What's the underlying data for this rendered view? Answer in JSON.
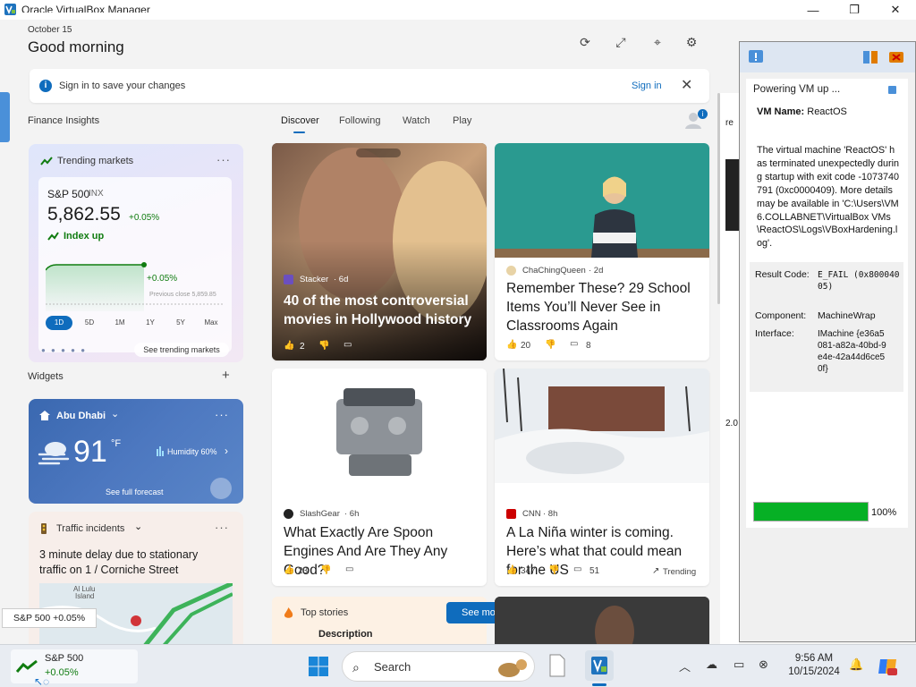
{
  "window": {
    "title": "Oracle VirtualBox Manager",
    "minimize": "—",
    "maximize": "❐",
    "close": "✕"
  },
  "widgets": {
    "date": "October 15",
    "greeting": "Good morning",
    "header_icons": [
      "refresh-icon",
      "expand-icon",
      "pin-icon",
      "settings-icon"
    ],
    "signin_banner": {
      "text": "Sign in to save your changes",
      "link": "Sign in",
      "close": "✕"
    },
    "finance_label": "Finance Insights",
    "tabs": [
      "Discover",
      "Following",
      "Watch",
      "Play"
    ],
    "profile_badge": "i",
    "markets": {
      "title": "Trending markets",
      "more": "···",
      "name": "S&P 500",
      "symbol": "INX",
      "value": "5,862.55",
      "change": "+0.05%",
      "trend": "Index up",
      "chart_pct": "+0.05%",
      "prev_close": "Previous close 5,859.85",
      "ranges": [
        "1D",
        "5D",
        "1M",
        "1Y",
        "5Y",
        "Max"
      ],
      "selected_range": "1D",
      "pager": "● ● ● ● ●",
      "see_link": "See trending markets"
    },
    "widgets_label": "Widgets",
    "add": "+",
    "weather": {
      "city": "Abu Dhabi",
      "chevron": "⌄",
      "more": "···",
      "temp": "91",
      "unit": "°F",
      "humidity": "Humidity 60%",
      "arrow": "›",
      "forecast_link": "See full forecast"
    },
    "traffic": {
      "title": "Traffic incidents",
      "chevron": "⌄",
      "more": "···",
      "text": "3 minute delay due to stationary traffic on 1 / Corniche Street",
      "map_label_1": "Al Lulu",
      "map_label_2": "Island"
    },
    "top_stories": {
      "label": "Top stories",
      "see_more": "See more",
      "arrow": "›"
    },
    "underlying_text": "Description"
  },
  "feed": [
    {
      "source": "Stacker",
      "age": "· 6d",
      "headline": "40 of the most controversial movies in Hollywood history",
      "likes": "2",
      "comments": ""
    },
    {
      "source": "ChaChingQueen",
      "age": "· 2d",
      "headline": "Remember These? 29 School Items You’ll Never See in Classrooms Again",
      "likes": "20",
      "comments": "8"
    },
    {
      "source": "SlashGear",
      "age": "· 6h",
      "headline": "What Exactly Are Spoon Engines And Are They Any Good?",
      "likes": "23",
      "comments": ""
    },
    {
      "source": "CNN",
      "age": "· 8h",
      "headline": "A La Niña winter is coming. Here’s what that could mean for the US",
      "likes": "347",
      "comments": "51",
      "tag": "Trending"
    }
  ],
  "popup": {
    "title": "Powering VM up ...",
    "vm_name_label": "VM Name: ",
    "vm_name": "ReactOS",
    "message": "The virtual machine 'ReactOS' has terminated unexpectedly during startup with exit code -1073740791 (0xc0000409). More details may be available in 'C:\\Users\\VM6.COLLABNET\\VirtualBox VMs\\ReactOS\\Logs\\VBoxHardening.log'.",
    "result_label": "Result Code:",
    "result_value": "E_FAIL (0x80004005)",
    "component_label": "Component:",
    "component_value": "MachineWrap",
    "interface_label": "Interface:",
    "interface_value": "IMachine {e36a5081-a82a-40bd-9e4e-42a44d6ce50f}",
    "progress": 1.0,
    "progress_label": "100%"
  },
  "strip_text": {
    "a": "re",
    "b": "2.0"
  },
  "tooltip": "S&P 500 +0.05%",
  "taskbar": {
    "widget_name": "S&P 500",
    "widget_change": "+0.05%",
    "search": "Search",
    "tray_chevron": "︿",
    "time": "9:56 AM",
    "date": "10/15/2024"
  },
  "colors": {
    "accent": "#0f6cbd",
    "positive": "#107c10",
    "progress": "#06b025"
  }
}
